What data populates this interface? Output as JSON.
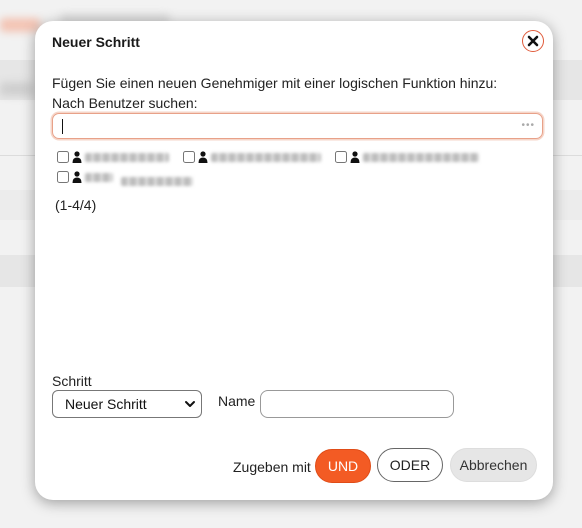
{
  "dialog": {
    "title": "Neuer Schritt",
    "intro": "Fügen Sie einen neuen Genehmiger mit einer logischen Funktion hinzu:",
    "search_label": "Nach Benutzer suchen:",
    "search_value": "",
    "more_icon": "•••",
    "count": "(1-4/4)",
    "step_label": "Schritt",
    "step_selected": "Neuer Schritt",
    "name_label": "Name",
    "name_value": "",
    "footer_label": "Zugeben mit",
    "btn_und": "UND",
    "btn_oder": "ODER",
    "btn_cancel": "Abbrechen"
  },
  "colors": {
    "accent": "#f35b24",
    "close_border": "#e05a3a",
    "search_border": "#e8a189"
  },
  "icons": {
    "close": "close-icon",
    "user": "person-icon",
    "more": "more-icon",
    "select": "chevron-down-icon"
  }
}
